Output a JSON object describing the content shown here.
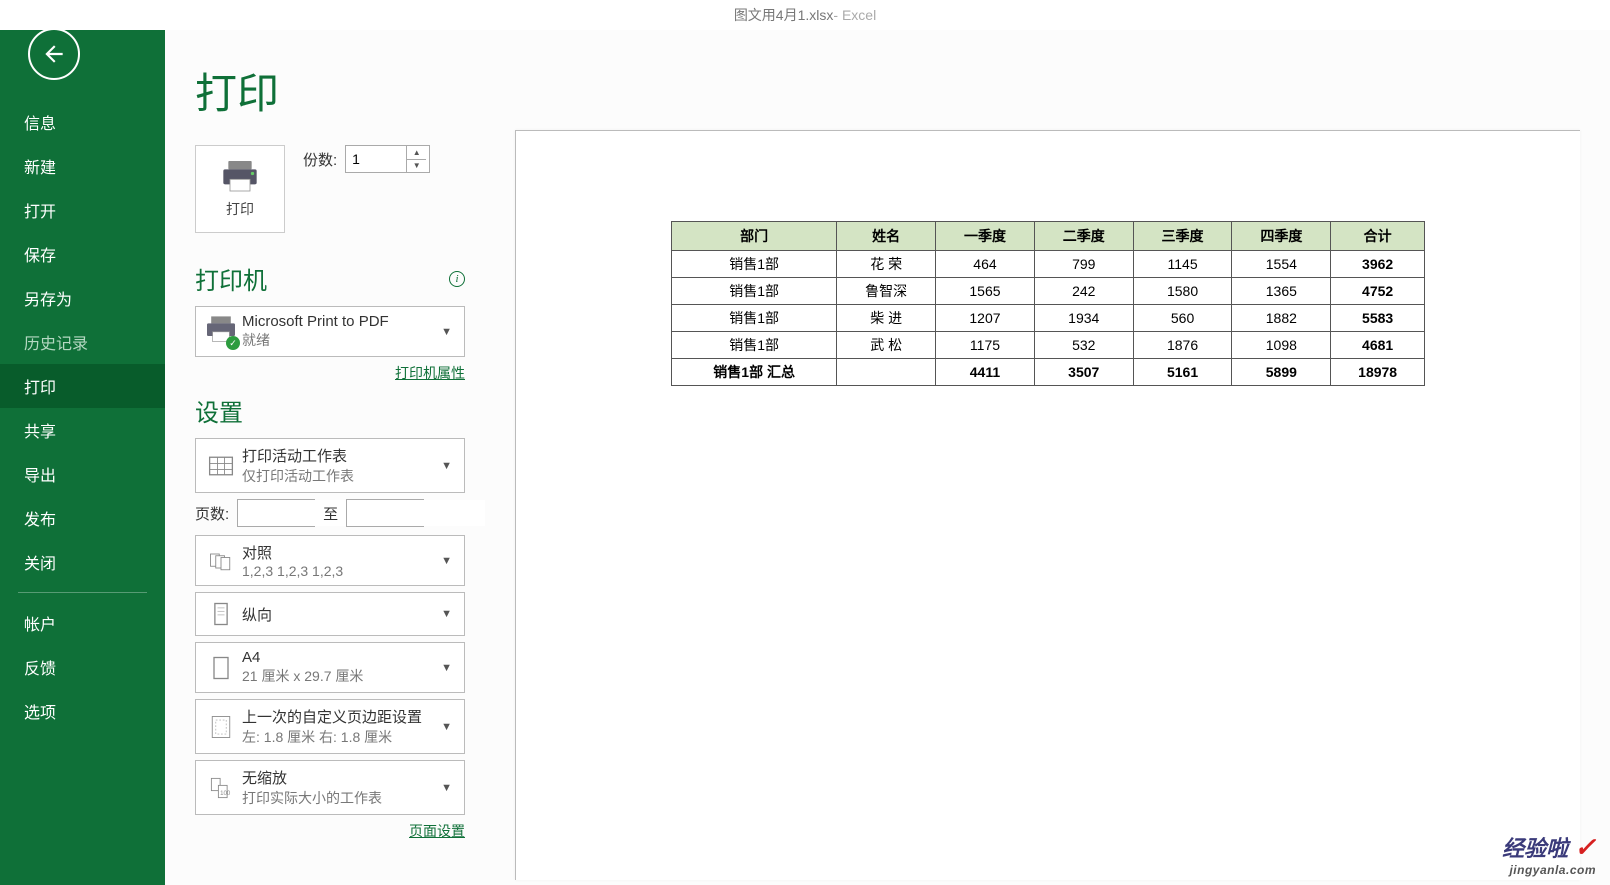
{
  "app": {
    "title_file": "图文用4月1.xlsx",
    "title_app": "  -  Excel"
  },
  "nav": {
    "items": [
      "信息",
      "新建",
      "打开",
      "保存",
      "另存为",
      "历史记录",
      "打印",
      "共享",
      "导出",
      "发布",
      "关闭"
    ],
    "account": "帐户",
    "feedback": "反馈",
    "options": "选项"
  },
  "page": {
    "title": "打印"
  },
  "print_button": {
    "label": "打印"
  },
  "copies": {
    "label": "份数:",
    "value": "1"
  },
  "printer_section": {
    "title": "打印机"
  },
  "printer_dd": {
    "name": "Microsoft Print to PDF",
    "status": "就绪"
  },
  "printer_props_link": "打印机属性",
  "settings_section": {
    "title": "设置"
  },
  "dd_sheets": {
    "line1": "打印活动工作表",
    "line2": "仅打印活动工作表"
  },
  "pages": {
    "label": "页数:",
    "to": "至"
  },
  "dd_collate": {
    "line1": "对照",
    "line2": "1,2,3    1,2,3    1,2,3"
  },
  "dd_orient": {
    "line1": "纵向"
  },
  "dd_paper": {
    "line1": "A4",
    "line2": "21 厘米 x 29.7 厘米"
  },
  "dd_margins": {
    "line1": "上一次的自定义页边距设置",
    "line2": "左:  1.8 厘米    右:  1.8 厘米"
  },
  "dd_scale": {
    "line1": "无缩放",
    "line2": "打印实际大小的工作表"
  },
  "page_setup_link": "页面设置",
  "preview_table": {
    "headers": [
      "部门",
      "姓名",
      "一季度",
      "二季度",
      "三季度",
      "四季度",
      "合计"
    ],
    "rows": [
      [
        "销售1部",
        "花  荣",
        "464",
        "799",
        "1145",
        "1554",
        "3962"
      ],
      [
        "销售1部",
        "鲁智深",
        "1565",
        "242",
        "1580",
        "1365",
        "4752"
      ],
      [
        "销售1部",
        "柴  进",
        "1207",
        "1934",
        "560",
        "1882",
        "5583"
      ],
      [
        "销售1部",
        "武  松",
        "1175",
        "532",
        "1876",
        "1098",
        "4681"
      ]
    ],
    "sum_row": [
      "销售1部 汇总",
      "",
      "4411",
      "3507",
      "5161",
      "5899",
      "18978"
    ]
  },
  "watermark": {
    "line1": "经验啦",
    "line2": "jingyanla.com"
  }
}
